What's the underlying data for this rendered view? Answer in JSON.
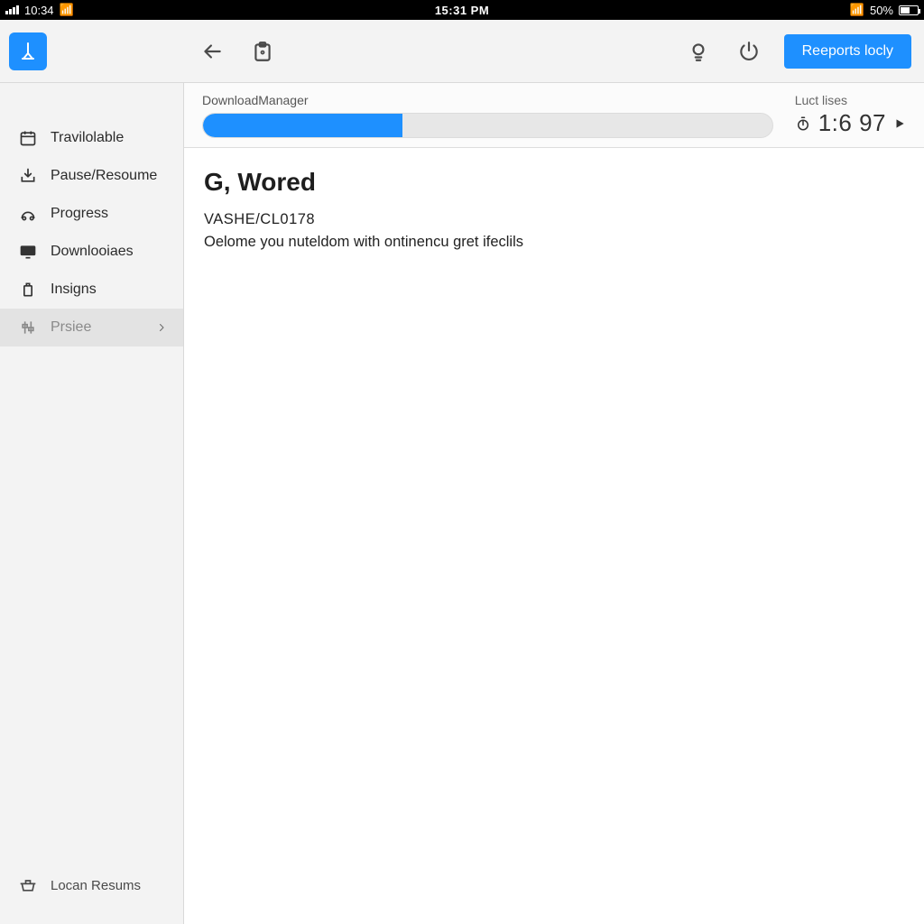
{
  "statusbar": {
    "time_left": "10:34",
    "clock": "15:31 PM",
    "battery_pct": "50%"
  },
  "toolbar": {
    "primary_btn": "Reeports locly"
  },
  "sidebar": {
    "items": [
      {
        "label": "Travilolable"
      },
      {
        "label": "Pause/Resoume"
      },
      {
        "label": "Progress"
      },
      {
        "label": "Downlooiaes"
      },
      {
        "label": "Insigns"
      },
      {
        "label": "Prsiee"
      }
    ],
    "footer_label": "Locan Resums"
  },
  "download": {
    "label": "DownloadManager",
    "progress_pct": 35,
    "meta_label": "Luct lises",
    "time_value": "1:6 97"
  },
  "page": {
    "heading": "G, Wored",
    "code": "VASHE/CL0178",
    "description": "Oelome you nuteldom with ontinencu gret ifeclils"
  }
}
